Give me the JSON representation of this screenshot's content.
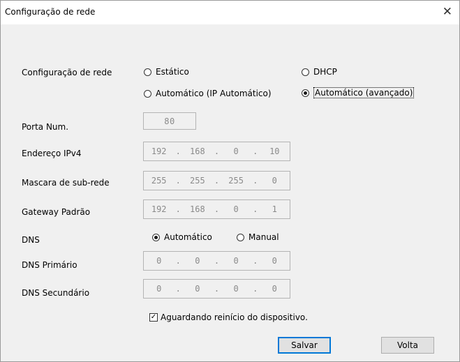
{
  "window": {
    "title": "Configuração de rede",
    "close_icon": "close-icon"
  },
  "network": {
    "label": "Configuração de rede",
    "options": {
      "static": "Estático",
      "dhcp": "DHCP",
      "auto_ip": "Automático (IP Automático)",
      "auto_advanced": "Automático (avançado)"
    },
    "selected": "auto_advanced"
  },
  "port": {
    "label": "Porta Num.",
    "value": "80"
  },
  "ipv4": {
    "label": "Endereço IPv4",
    "octets": [
      "192",
      "168",
      "0",
      "10"
    ]
  },
  "subnet": {
    "label": "Mascara de sub-rede",
    "octets": [
      "255",
      "255",
      "255",
      "0"
    ]
  },
  "gateway": {
    "label": "Gateway Padrão",
    "octets": [
      "192",
      "168",
      "0",
      "1"
    ]
  },
  "dns": {
    "label": "DNS",
    "automatic": "Automático",
    "manual": "Manual",
    "selected": "automatic",
    "primary_label": "DNS Primário",
    "primary_octets": [
      "0",
      "0",
      "0",
      "0"
    ],
    "secondary_label": "DNS Secundário",
    "secondary_octets": [
      "0",
      "0",
      "0",
      "0"
    ]
  },
  "reboot": {
    "label": "Aguardando reinício do dispositivo.",
    "checked": true
  },
  "buttons": {
    "save": "Salvar",
    "back": "Volta"
  },
  "colors": {
    "default_button_border": "#0078d7",
    "background": "#f0f0f0"
  }
}
